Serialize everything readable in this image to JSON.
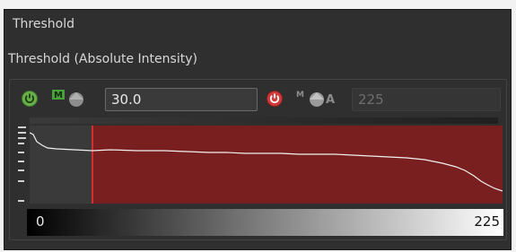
{
  "panel": {
    "title": "Threshold",
    "subtitle": "Threshold (Absolute Intensity)"
  },
  "controls": {
    "lower_value": "30.0",
    "upper_value": "225",
    "icons": [
      "power-green-icon",
      "min-gray-icon",
      "power-red-icon",
      "max-gray-icon"
    ]
  },
  "histogram": {
    "range_min_label": "0",
    "range_max_label": "225",
    "threshold_color": "#8a2020",
    "below_color": "#3c3c3c",
    "line_color": "#f0f0f0"
  }
}
